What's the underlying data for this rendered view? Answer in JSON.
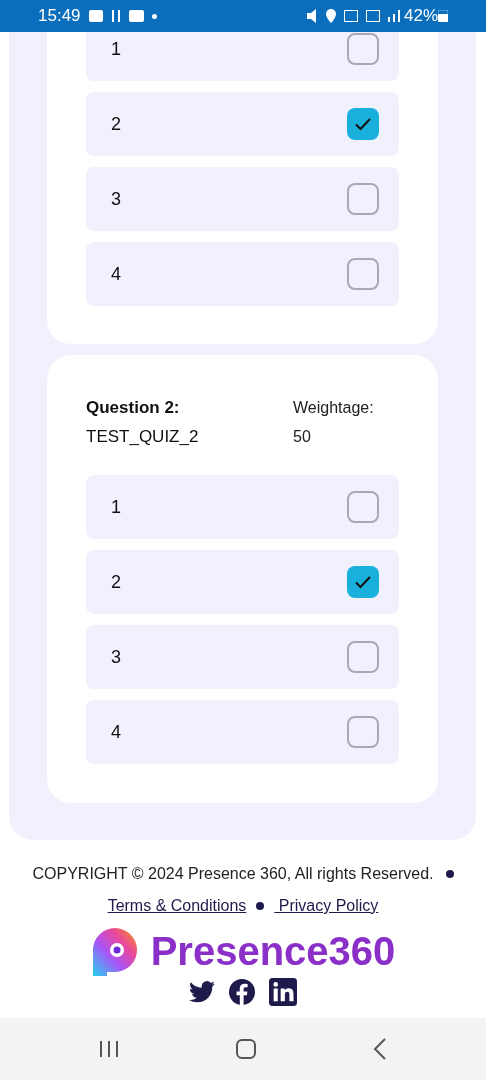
{
  "status_bar": {
    "time": "15:49",
    "battery": "42%"
  },
  "questions": [
    {
      "options": [
        {
          "label": "1",
          "selected": false
        },
        {
          "label": "2",
          "selected": true
        },
        {
          "label": "3",
          "selected": false
        },
        {
          "label": "4",
          "selected": false
        }
      ]
    },
    {
      "heading": "Question 2:",
      "name": "TEST_QUIZ_2",
      "weightage_label": "Weightage:",
      "weightage": "50",
      "options": [
        {
          "label": "1",
          "selected": false
        },
        {
          "label": "2",
          "selected": true
        },
        {
          "label": "3",
          "selected": false
        },
        {
          "label": "4",
          "selected": false
        }
      ]
    }
  ],
  "footer": {
    "copyright": "COPYRIGHT © 2024 Presence 360, All rights Reserved.",
    "links": [
      "Terms & Conditions",
      " Privacy Policy"
    ],
    "brand": "Presence360"
  }
}
